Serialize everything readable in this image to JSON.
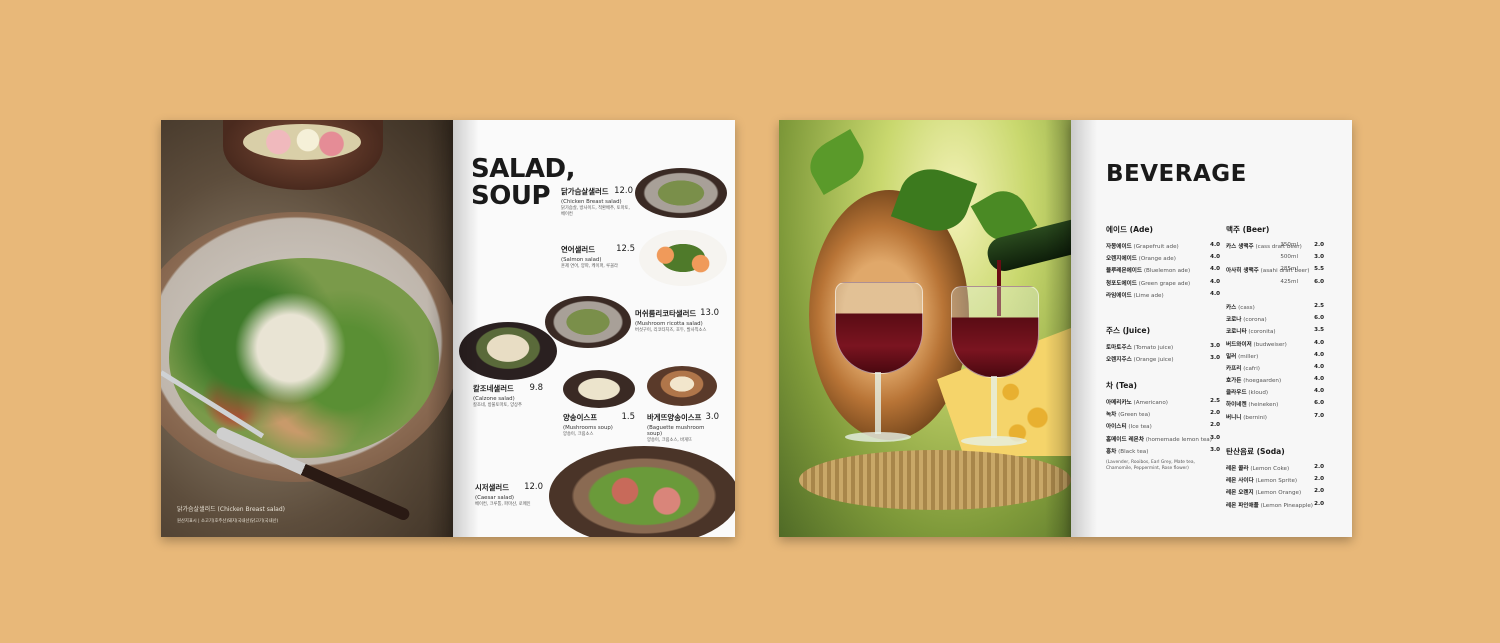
{
  "salad_page": {
    "photo_caption": "닭가슴살샐러드 (Chicken Breast salad)",
    "photo_sub": "원산지표시 | 소고기(호주산)돼지(국내산)닭고기(국내산)",
    "title_line1": "SALAD,",
    "title_line2": "SOUP",
    "items": [
      {
        "name": "닭가슴살샐러드",
        "price": "12.0",
        "eng": "(Chicken Breast salad)",
        "desc": "닭가슴살, 방사이드, 적환배추, 토마토, 베이컨"
      },
      {
        "name": "연어샐러드",
        "price": "12.5",
        "eng": "(Salmon salad)",
        "desc": "훈제 연어, 양파, 케이퍼, 루꼴라"
      },
      {
        "name": "머쉬룸리코타샐러드",
        "price": "13.0",
        "eng": "(Mushroom ricotta salad)",
        "desc": "버섯구이, 리코타치즈, 호두, 발사믹소스"
      },
      {
        "name": "칼조네샐러드",
        "price": "9.8",
        "eng": "(Calzone salad)",
        "desc": "칼조네, 방울토마토, 양상추"
      },
      {
        "name": "양송이스프",
        "price": "1.5",
        "eng": "(Mushrooms soup)",
        "desc": "양송이, 크림소스"
      },
      {
        "name": "바게뜨양송이스프",
        "price": "3.0",
        "eng": "(Baguette mushroom soup)",
        "desc": "양송이, 크림소스, 바게뜨"
      },
      {
        "name": "시저샐러드",
        "price": "12.0",
        "eng": "(Caesar salad)",
        "desc": "베이컨, 크루통, 파마산, 로메인"
      }
    ]
  },
  "beverage_page": {
    "title": "BEVERAGE",
    "sections": [
      {
        "head": "에이드 (Ade)",
        "rows": [
          {
            "ko": "자몽에이드",
            "en": "(Grapefruit ade)",
            "price": "4.0"
          },
          {
            "ko": "오렌지에이드",
            "en": "(Orange ade)",
            "price": "4.0"
          },
          {
            "ko": "블루레몬에이드",
            "en": "(Bluelemon ade)",
            "price": "4.0"
          },
          {
            "ko": "청포도에이드",
            "en": "(Green grape ade)",
            "price": "4.0"
          },
          {
            "ko": "라임에이드",
            "en": "(Lime ade)",
            "price": "4.0"
          }
        ]
      },
      {
        "head": "주스 (Juice)",
        "rows": [
          {
            "ko": "토마토주스",
            "en": "(Tomato juice)",
            "price": "3.0"
          },
          {
            "ko": "오렌지주스",
            "en": "(Orange juice)",
            "price": "3.0"
          }
        ]
      },
      {
        "head": "차 (Tea)",
        "rows": [
          {
            "ko": "아메리카노",
            "en": "(Americano)",
            "price": "2.5"
          },
          {
            "ko": "녹차",
            "en": "(Green tea)",
            "price": "2.0"
          },
          {
            "ko": "아이스티",
            "en": "(Ice tea)",
            "price": "2.0"
          },
          {
            "ko": "홈메이드 레몬차",
            "en": "(homemade lemon tea)",
            "price": "3.0"
          },
          {
            "ko": "홍차",
            "en": "(Black tea)",
            "price": "3.0"
          }
        ],
        "note": "(Lavender, Rooibos, Earl Grey, Mate tea, Chamomile, Peppermint, Rose flower)"
      },
      {
        "head": "맥주 (Beer)",
        "rows": [
          {
            "ko": "카스 생맥주",
            "en": "(cass draft beer)",
            "vol": "350ml",
            "price": "2.0"
          },
          {
            "ko": "",
            "en": "",
            "vol": "500ml",
            "price": "3.0"
          },
          {
            "ko": "아사히 생맥주",
            "en": "(asahi draft beer)",
            "vol": "285ml",
            "price": "5.5"
          },
          {
            "ko": "",
            "en": "",
            "vol": "425ml",
            "price": "6.0"
          },
          {
            "ko": "",
            "en": "",
            "vol": "",
            "price": ""
          },
          {
            "ko": "카스",
            "en": "(cass)",
            "price": "2.5"
          },
          {
            "ko": "코로나",
            "en": "(corona)",
            "price": "6.0"
          },
          {
            "ko": "코로니타",
            "en": "(coronita)",
            "price": "3.5"
          },
          {
            "ko": "버드와이저",
            "en": "(budweiser)",
            "price": "4.0"
          },
          {
            "ko": "밀러",
            "en": "(miller)",
            "price": "4.0"
          },
          {
            "ko": "카프리",
            "en": "(cafri)",
            "price": "4.0"
          },
          {
            "ko": "호가든",
            "en": "(hoegaarden)",
            "price": "4.0"
          },
          {
            "ko": "클라우드",
            "en": "(kloud)",
            "price": "4.0"
          },
          {
            "ko": "하이네켄",
            "en": "(heineken)",
            "price": "6.0"
          },
          {
            "ko": "버니니",
            "en": "(bernini)",
            "price": "7.0"
          }
        ]
      },
      {
        "head": "탄산음료 (Soda)",
        "rows": [
          {
            "ko": "레몬 콜라",
            "en": "(Lemon Coke)",
            "price": "2.0"
          },
          {
            "ko": "레몬 사이다",
            "en": "(Lemon Sprite)",
            "price": "2.0"
          },
          {
            "ko": "레몬 오렌지",
            "en": "(Lemon Orange)",
            "price": "2.0"
          },
          {
            "ko": "레몬 파인애플",
            "en": "(Lemon Pineapple)",
            "price": "2.0"
          }
        ]
      }
    ]
  },
  "colors": {
    "background": "#e8b879",
    "text": "#1a1a1a"
  }
}
